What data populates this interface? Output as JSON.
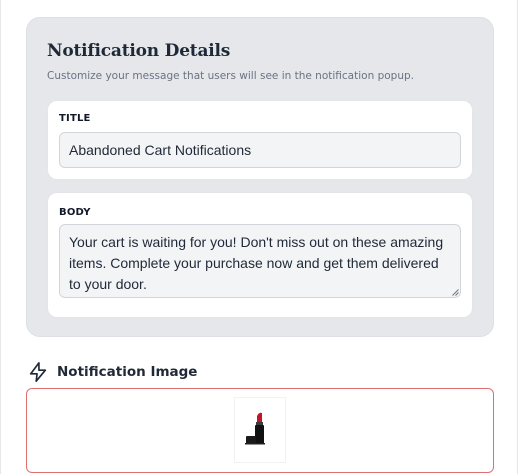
{
  "details": {
    "heading": "Notification Details",
    "subheading": "Customize your message that users will see in the notification popup."
  },
  "title_field": {
    "label": "TITLE",
    "value": "Abandoned Cart Notifications"
  },
  "body_field": {
    "label": "BODY",
    "value": "Your cart is waiting for you! Don't miss out on these amazing items. Complete your purchase now and get them delivered to your door."
  },
  "image_section": {
    "label": "Notification Image",
    "icon": "lightning-bolt-icon",
    "thumbnail_icon": "lipstick-product-thumbnail"
  },
  "colors": {
    "card_background": "#e5e7eb",
    "dropzone_border": "#e07070",
    "lipstick_red": "#c0152a"
  }
}
